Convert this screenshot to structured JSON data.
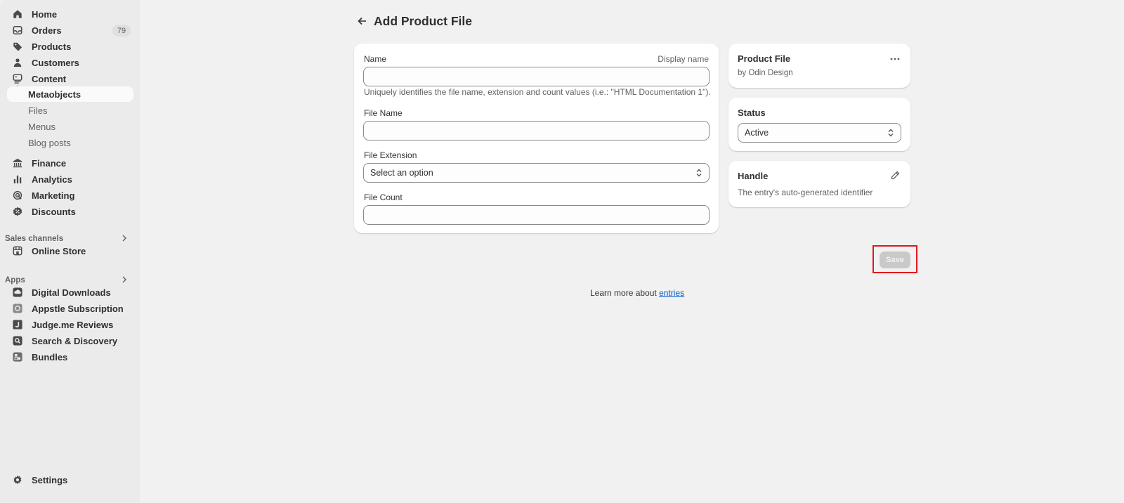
{
  "sidebar": {
    "items": [
      {
        "label": "Home",
        "icon": "home-icon"
      },
      {
        "label": "Orders",
        "icon": "inbox-icon",
        "badge": "79"
      },
      {
        "label": "Products",
        "icon": "tag-icon"
      },
      {
        "label": "Customers",
        "icon": "person-icon"
      },
      {
        "label": "Content",
        "icon": "content-icon"
      },
      {
        "label": "Metaobjects",
        "active": true
      },
      {
        "label": "Files"
      },
      {
        "label": "Menus"
      },
      {
        "label": "Blog posts"
      },
      {
        "label": "Finance",
        "icon": "bank-icon"
      },
      {
        "label": "Analytics",
        "icon": "bar-chart-icon"
      },
      {
        "label": "Marketing",
        "icon": "target-icon"
      },
      {
        "label": "Discounts",
        "icon": "discount-icon"
      }
    ],
    "sales_channels_label": "Sales channels",
    "online_store_label": "Online Store",
    "apps_label": "Apps",
    "apps": [
      {
        "label": "Digital Downloads",
        "icon": "cloud-download-icon"
      },
      {
        "label": "Appstle Subscription",
        "icon": "appstle-icon"
      },
      {
        "label": "Judge.me Reviews",
        "icon": "judgeme-icon"
      },
      {
        "label": "Search & Discovery",
        "icon": "search-discovery-icon"
      },
      {
        "label": "Bundles",
        "icon": "bundles-icon"
      }
    ],
    "settings_label": "Settings"
  },
  "header": {
    "title": "Add Product File"
  },
  "form": {
    "name_label": "Name",
    "name_aside": "Display name",
    "name_value": "",
    "name_help": "Uniquely identifies the file name, extension and count values (i.e.: \"HTML Documentation 1\").",
    "file_name_label": "File Name",
    "file_name_value": "",
    "file_extension_label": "File Extension",
    "file_extension_value": "Select an option",
    "file_count_label": "File Count",
    "file_count_value": ""
  },
  "product_card": {
    "title": "Product File",
    "subtitle": "by Odin Design"
  },
  "status_card": {
    "title": "Status",
    "value": "Active"
  },
  "handle_card": {
    "title": "Handle",
    "description": "The entry's auto-generated identifier"
  },
  "actions": {
    "save_label": "Save"
  },
  "footer": {
    "learn_more_prefix": "Learn more about ",
    "learn_more_link": "entries"
  },
  "colors": {
    "background": "#f1f1f1",
    "sidebar": "#ebebeb",
    "link": "#005bd3",
    "highlight": "#e0161f"
  }
}
